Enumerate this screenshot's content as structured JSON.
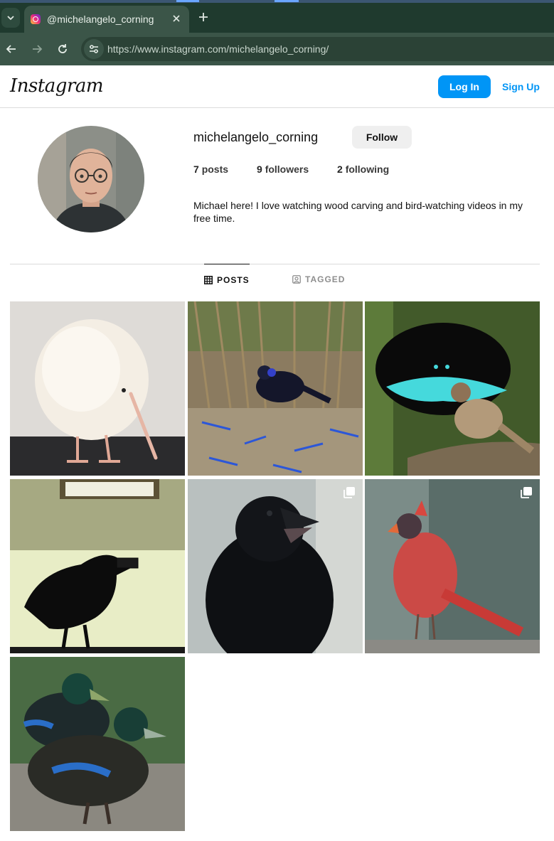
{
  "browser": {
    "tab_title": "@michelangelo_corning",
    "url_host": "https://www.instagram.com/",
    "url_path": "michelangelo_corning/"
  },
  "header": {
    "logo": "Instagram",
    "login_label": "Log In",
    "signup_label": "Sign Up"
  },
  "profile": {
    "username": "michelangelo_corning",
    "follow_label": "Follow",
    "posts_count": "7",
    "posts_label": "posts",
    "followers_count": "9",
    "followers_label": "followers",
    "following_count": "2",
    "following_label": "following",
    "bio": "Michael here! I love watching wood carving and bird-watching videos in my free time."
  },
  "tabs": {
    "posts_label": "POSTS",
    "tagged_label": "TAGGED"
  },
  "posts": [
    {
      "subject": "white kiwi bird",
      "multi": false
    },
    {
      "subject": "bowerbird with blue objects",
      "multi": false
    },
    {
      "subject": "bird of paradise display",
      "multi": false
    },
    {
      "subject": "crow silhouette",
      "multi": false
    },
    {
      "subject": "raven",
      "multi": true
    },
    {
      "subject": "red cardinal",
      "multi": true
    },
    {
      "subject": "black ducks",
      "multi": false
    }
  ],
  "colors": {
    "accent": "#0095f6",
    "chrome_dark": "#1f3a2e",
    "chrome_mid": "#3b5548"
  }
}
